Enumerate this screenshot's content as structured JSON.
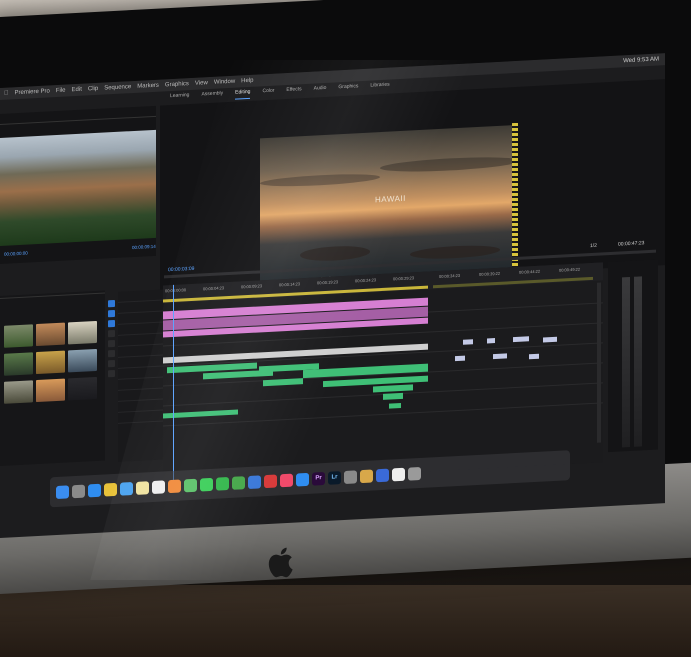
{
  "menubar": {
    "items": [
      "Premiere Pro",
      "File",
      "Edit",
      "Clip",
      "Sequence",
      "Markers",
      "Graphics",
      "View",
      "Window",
      "Help"
    ],
    "clock": "Wed 9:53 AM"
  },
  "workspace_tabs": [
    "Learning",
    "Assembly",
    "Editing",
    "Color",
    "Effects",
    "Audio",
    "Graphics",
    "Libraries"
  ],
  "active_workspace": "Editing",
  "source_monitor": {
    "timecode": "00:00:09:14"
  },
  "program_monitor": {
    "overlay_title": "HAWAII",
    "timecode_left": "00:00:03:09",
    "timecode_right": "00:00:47:23",
    "fit": "1/2"
  },
  "timeline": {
    "sequence_timecode": "00:00:03:09",
    "ruler": [
      "00:00:00:00",
      "00:00:04:23",
      "00:00:09:23",
      "00:00:14:23",
      "00:00:19:23",
      "00:00:24:23",
      "00:00:29:23",
      "00:00:34:23",
      "00:00:39:22",
      "00:00:44:22",
      "00:00:49:22"
    ]
  },
  "dock": {
    "apps": [
      {
        "icon": "finder-icon",
        "color": "#3a8df0",
        "label": ""
      },
      {
        "icon": "launchpad-icon",
        "color": "#8a8a8a",
        "label": ""
      },
      {
        "icon": "safari-icon",
        "color": "#2f8df0",
        "label": ""
      },
      {
        "icon": "chrome-icon",
        "color": "#e8c23a",
        "label": ""
      },
      {
        "icon": "mail-icon",
        "color": "#4aa3f0",
        "label": ""
      },
      {
        "icon": "notes-icon",
        "color": "#f0e3a0",
        "label": ""
      },
      {
        "icon": "reminders-icon",
        "color": "#eeeeee",
        "label": ""
      },
      {
        "icon": "photos-icon",
        "color": "#f08a3a",
        "label": ""
      },
      {
        "icon": "maps-icon",
        "color": "#5cc26a",
        "label": ""
      },
      {
        "icon": "messages-icon",
        "color": "#3ccf5a",
        "label": ""
      },
      {
        "icon": "facetime-icon",
        "color": "#34b84d",
        "label": ""
      },
      {
        "icon": "numbers-icon",
        "color": "#46a84a",
        "label": ""
      },
      {
        "icon": "keynote-icon",
        "color": "#3a78d8",
        "label": ""
      },
      {
        "icon": "no-entry-icon",
        "color": "#d83a3a",
        "label": ""
      },
      {
        "icon": "music-icon",
        "color": "#f04a6a",
        "label": ""
      },
      {
        "icon": "app-store-icon",
        "color": "#2f8df0",
        "label": ""
      },
      {
        "icon": "premiere-pro-icon",
        "color": "#2a0a3a",
        "label": "Pr"
      },
      {
        "icon": "lightroom-icon",
        "color": "#0a1a2a",
        "label": "Lr"
      },
      {
        "icon": "system-preferences-icon",
        "color": "#8a8a8a",
        "label": ""
      },
      {
        "icon": "folder-icon",
        "color": "#d8a84a",
        "label": ""
      },
      {
        "icon": "downloads-icon",
        "color": "#3a6ad8",
        "label": ""
      },
      {
        "icon": "file-icon",
        "color": "#eeeeee",
        "label": ""
      },
      {
        "icon": "trash-icon",
        "color": "#9a9a9a",
        "label": ""
      }
    ]
  }
}
